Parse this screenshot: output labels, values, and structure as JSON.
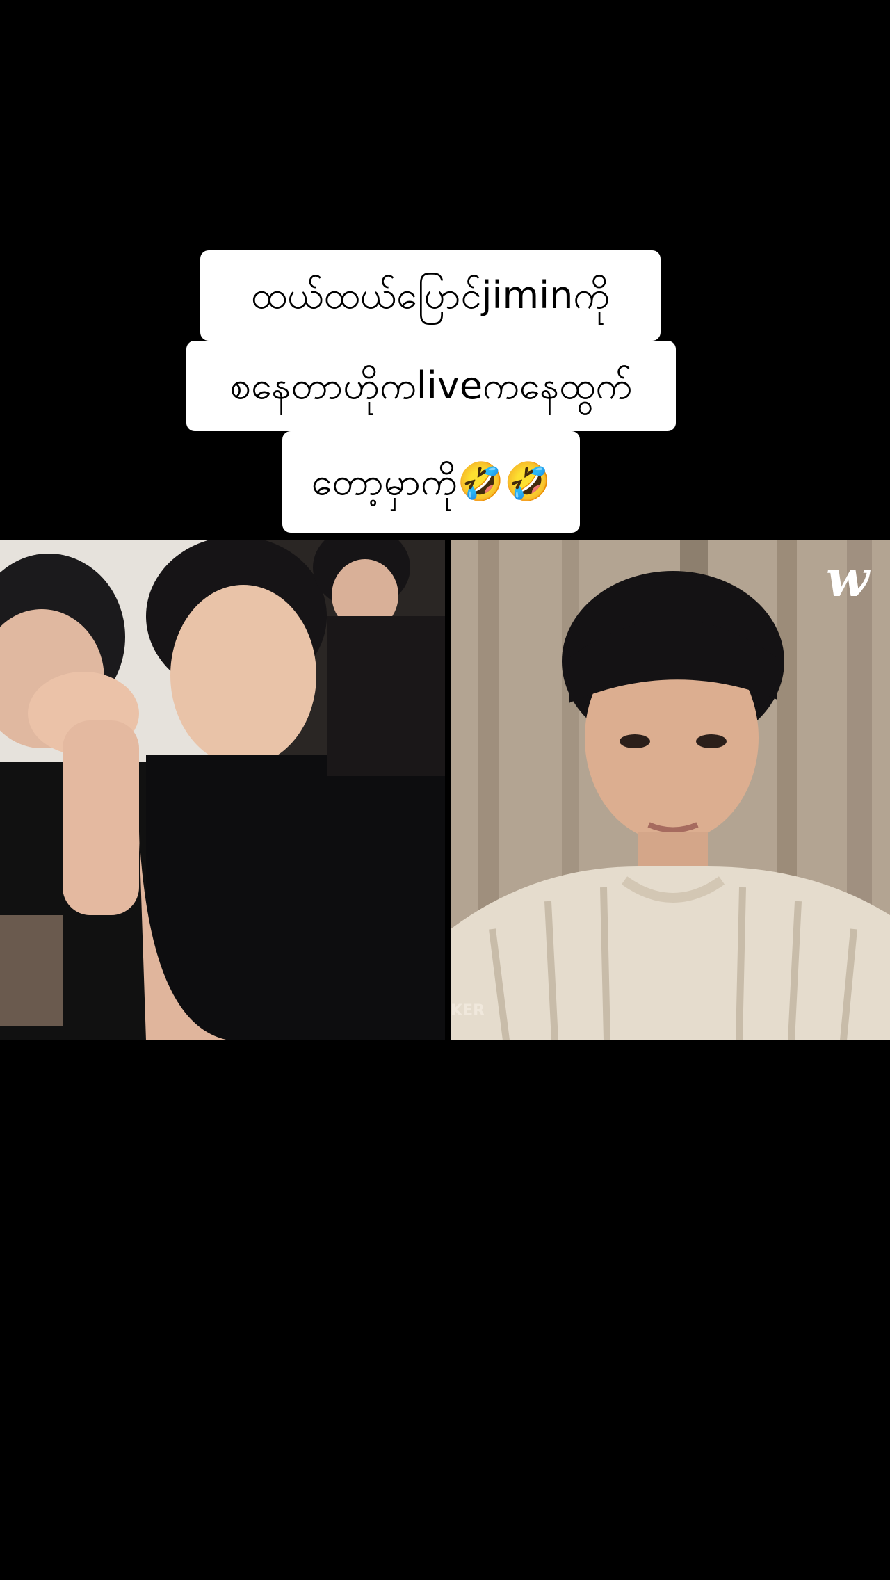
{
  "caption": {
    "line1": "ထယ်ထယ်ပြောင်jiminကို",
    "line2": "စနေတာဟိုကliveကနေထွက်",
    "line3": "တော့မှာကို🤣🤣"
  },
  "video_right": {
    "logo": "w",
    "partial_text": "KER"
  }
}
